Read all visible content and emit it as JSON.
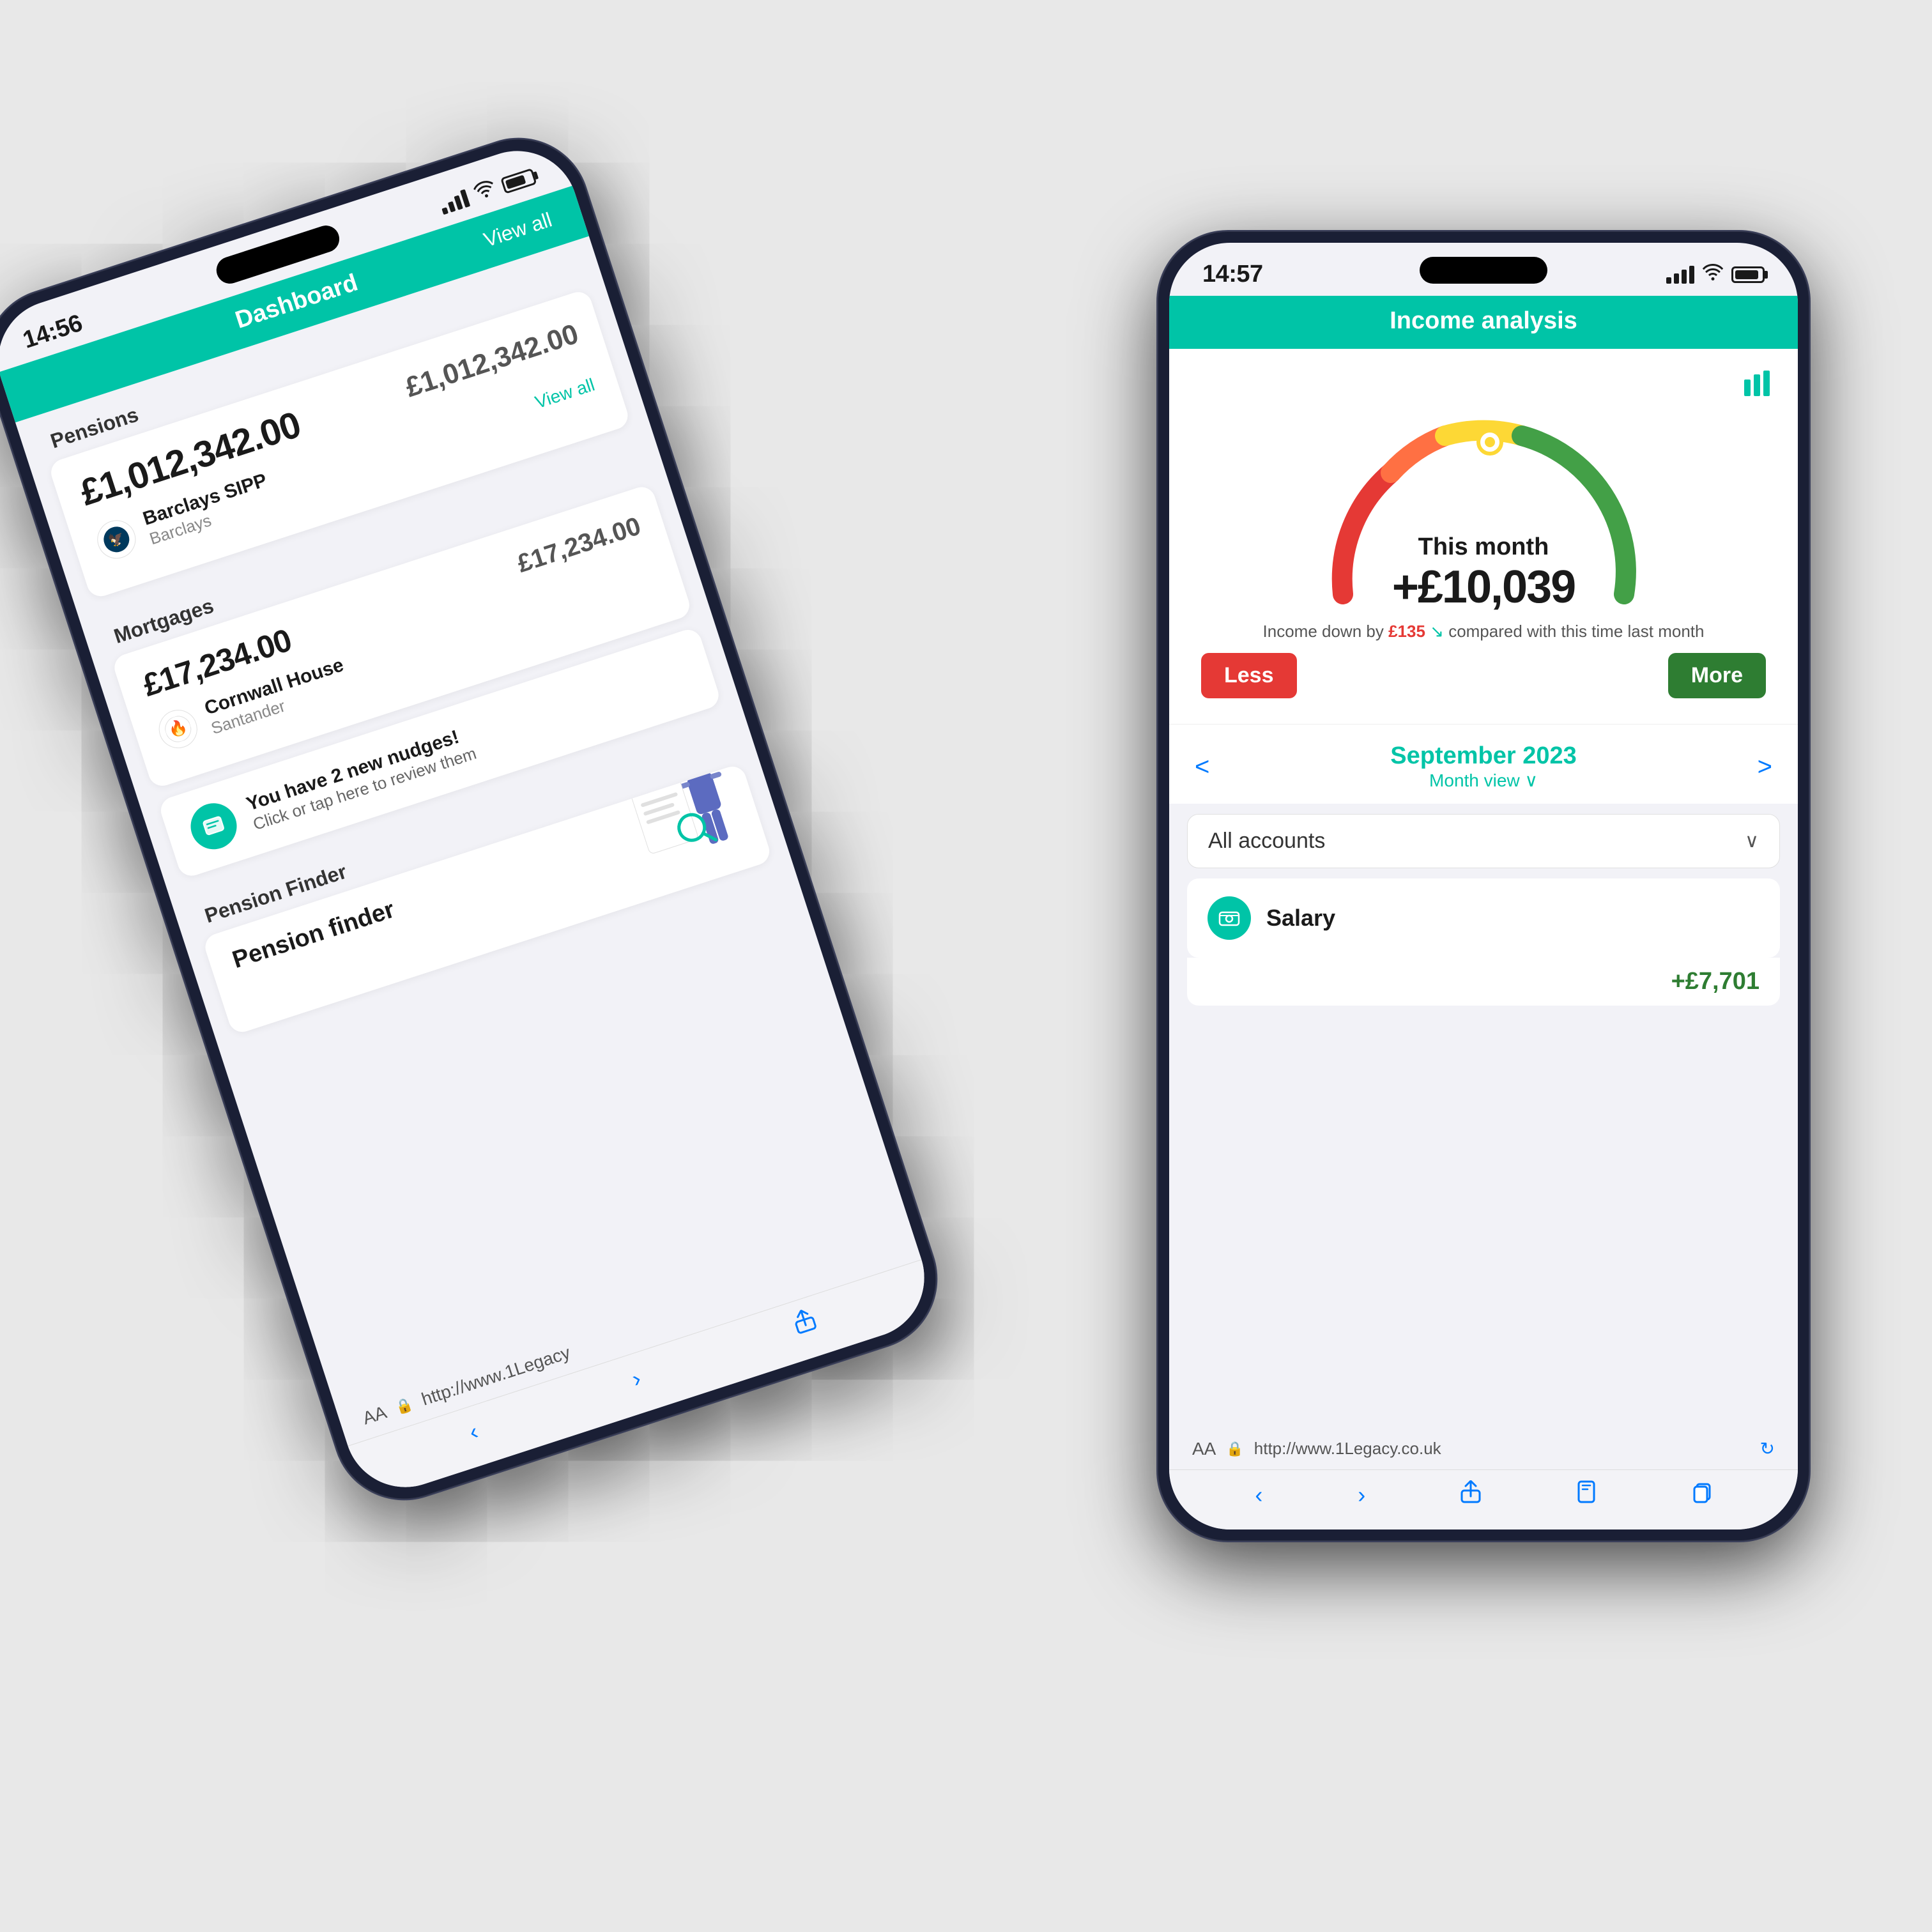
{
  "phone1": {
    "status_time": "14:56",
    "header_title": "Dashboard",
    "header_link": "View all",
    "pensions": {
      "label": "Pensions",
      "total": "£1,012,342.00",
      "total_right": "£1,012,342.00",
      "account_name": "Barclays SIPP",
      "account_bank": "Barclays",
      "view_all": "View all"
    },
    "mortgages": {
      "label": "Mortgages",
      "total": "£17,234.00",
      "total_right": "£17,234.00",
      "account_name": "Cornwall House",
      "account_bank": "Santander"
    },
    "nudge": {
      "title": "You have 2 new nudges!",
      "subtitle": "Click or tap here to review them"
    },
    "pension_finder_label": "Pension Finder",
    "pension_finder_title": "Pension finder",
    "browser_url": "http://www.1Legacy",
    "browser_text": "AA"
  },
  "phone2": {
    "status_time": "14:57",
    "header_title": "Income analysis",
    "gauge": {
      "this_month_label": "This month",
      "amount": "+£10,039",
      "comparison_prefix": "Income down by ",
      "comparison_amount": "£135",
      "comparison_suffix": " compared with this time last month",
      "arrow_symbol": "↘",
      "label_less": "Less",
      "label_more": "More"
    },
    "date_nav": {
      "month": "September 2023",
      "view": "Month view ∨",
      "prev_arrow": "<",
      "next_arrow": ">"
    },
    "account_selector": {
      "text": "All accounts",
      "chevron": "∨"
    },
    "salary": {
      "name": "Salary",
      "amount": "+£7,701"
    },
    "browser_url": "http://www.1Legacy.co.uk",
    "browser_text": "AA",
    "icons": {
      "bar_chart": "chart",
      "salary_icon": "💷"
    }
  }
}
